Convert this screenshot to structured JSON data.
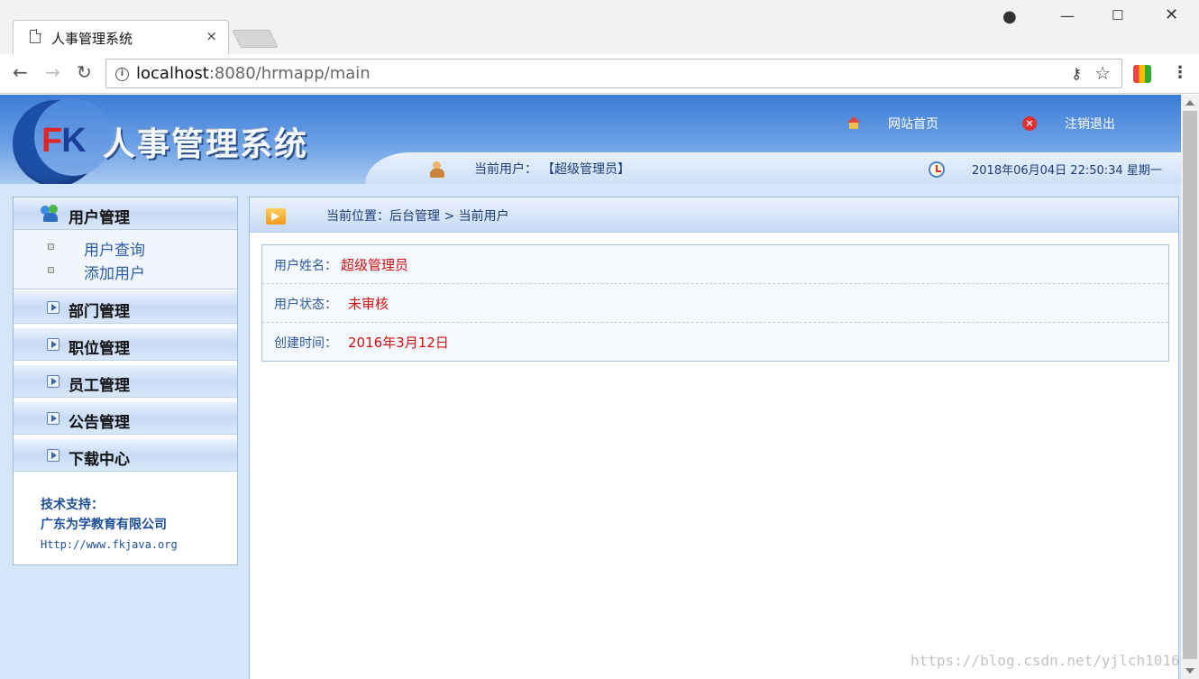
{
  "browser": {
    "tab_title": "人事管理系统",
    "tab_close": "×",
    "url_host": "localhost",
    "url_rest": ":8080/hrmapp/main"
  },
  "header": {
    "logo_f": "F",
    "logo_k": "K",
    "title": "人事管理系统",
    "home_link": "网站首页",
    "logout_link": "注销退出",
    "current_user_label": "当前用户：",
    "current_user_value": "【超级管理员】",
    "datetime": "2018年06月04日 22:50:34 星期一"
  },
  "sidebar": {
    "user_menu": {
      "label": "用户管理",
      "items": [
        "用户查询",
        "添加用户"
      ]
    },
    "menus": [
      "部门管理",
      "职位管理",
      "员工管理",
      "公告管理",
      "下载中心"
    ],
    "support": {
      "title": "技术支持：",
      "company": "广东为学教育有限公司",
      "url": "Http://www.fkjava.org"
    }
  },
  "main": {
    "breadcrumb": "当前位置：后台管理 > 当前用户",
    "rows": [
      {
        "label": "用户姓名：",
        "value": "超级管理员"
      },
      {
        "label": "用户状态：",
        "value": "未审核"
      },
      {
        "label": "创建时间：",
        "value": "2016年3月12日"
      }
    ]
  },
  "watermark": "https://blog.csdn.net/yjlch1016"
}
